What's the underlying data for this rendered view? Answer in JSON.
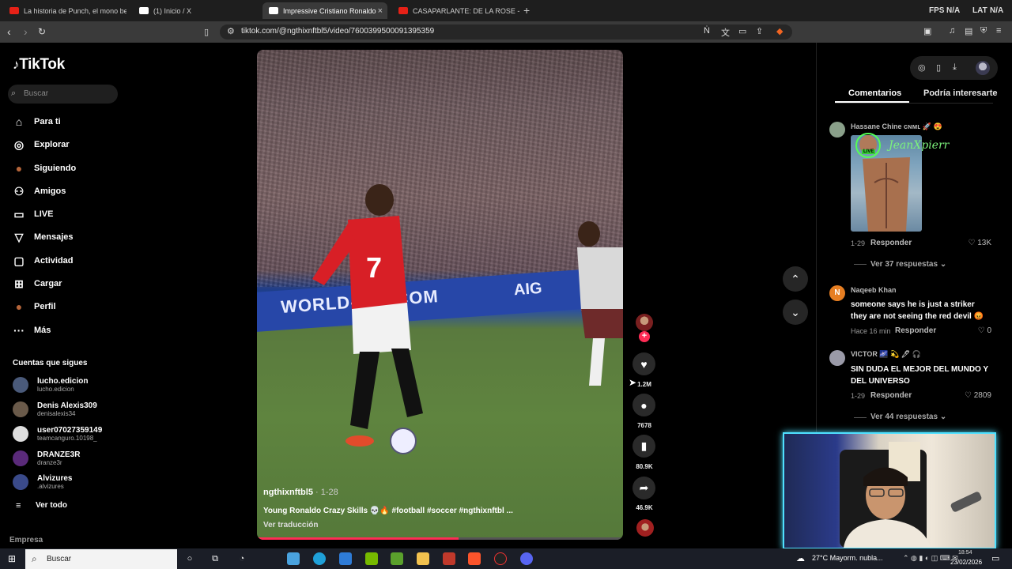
{
  "browser": {
    "tabs": [
      {
        "title": "La historia de Punch, el mono bebé, ...",
        "color": "#e62117",
        "active": false
      },
      {
        "title": "(1) Inicio / X",
        "color": "#ffffff",
        "active": false
      },
      {
        "title": "Impressive Cristiano Ronaldo",
        "color": "#ffffff",
        "active": true
      },
      {
        "title": "CASAPARLANTE: DE LA ROSE - YouTube",
        "color": "#e62117",
        "active": false
      }
    ],
    "new_tab": "+",
    "fps_label": "FPS",
    "fps_value": "N/A",
    "lat_label": "LAT",
    "lat_value": "N/A",
    "url": "tiktok.com/@ngthixnftbl5/video/7600399500091395359"
  },
  "sidebar": {
    "logo": "TikTok",
    "search_placeholder": "Buscar",
    "nav": [
      {
        "label": "Para ti",
        "icon": "home-icon",
        "glyph": "⌂"
      },
      {
        "label": "Explorar",
        "icon": "compass-icon",
        "glyph": "◎"
      },
      {
        "label": "Siguiendo",
        "icon": "following-avatar-icon",
        "glyph": "●"
      },
      {
        "label": "Amigos",
        "icon": "friends-icon",
        "glyph": "⚇"
      },
      {
        "label": "LIVE",
        "icon": "live-tv-icon",
        "glyph": "▭"
      },
      {
        "label": "Mensajes",
        "icon": "messages-icon",
        "glyph": "▽"
      },
      {
        "label": "Actividad",
        "icon": "activity-icon",
        "glyph": "▢"
      },
      {
        "label": "Cargar",
        "icon": "upload-icon",
        "glyph": "⊞"
      },
      {
        "label": "Perfil",
        "icon": "profile-avatar-icon",
        "glyph": "●"
      },
      {
        "label": "Más",
        "icon": "more-icon",
        "glyph": "···"
      }
    ],
    "following_title": "Cuentas que sigues",
    "accounts": [
      {
        "name": "lucho.edicion",
        "handle": "lucho.edicion",
        "color": "#4a5a7a"
      },
      {
        "name": "Denis Alexis309",
        "handle": "denisalexis34",
        "color": "#6a5a4a"
      },
      {
        "name": "user07027359149",
        "handle": "teamcanguro.10198_",
        "color": "#dddddd"
      },
      {
        "name": "DRANZE3R",
        "handle": "dranze3r",
        "color": "#5a2a7a"
      },
      {
        "name": "Alvizures",
        "handle": ".alvizures",
        "color": "#3a4a8a"
      }
    ],
    "see_all": "Ver todo",
    "footer": "Empresa"
  },
  "video": {
    "banner_text": "WORLD-AIG.COM",
    "aig": "AIG",
    "author": "ngthixnftbl5",
    "date": " · 1-28",
    "caption": "Young Ronaldo Crazy Skills 💀🔥 #football #soccer #ngthixnftbl ...",
    "translate": "Ver traducción",
    "progress": 0.55,
    "likes": "1.2M",
    "comments": "7678",
    "saves": "80.9K",
    "shares": "46.9K"
  },
  "panel": {
    "tab_comments": "Comentarios",
    "tab_suggest": "Podría interesarte",
    "sticker_text": "JeanXpierr",
    "live_tag": "LIVE",
    "comments": [
      {
        "name": "Hassane Chine ᴄɴᴍʟ 🚀 😍",
        "text": "",
        "date": "1-29",
        "reply": "Responder",
        "likes": "13K",
        "more": "Ver 37 respuestas",
        "avatar": "#8aa08a"
      },
      {
        "name": "Naqeeb Khan",
        "text": "someone says he is just a striker they are not seeing the red devil 😡",
        "date": "Hace 16 min",
        "reply": "Responder",
        "likes": "0",
        "more": "",
        "avatar": "#e67e22"
      },
      {
        "name": "VICTOR 🌌 💫 🖊 🎧",
        "text": "SIN DUDA EL MEJOR DEL MUNDO Y DEL UNIVERSO",
        "date": "1-29",
        "reply": "Responder",
        "likes": "2809",
        "more": "Ver 44 respuestas",
        "avatar": "#9a9aa8"
      }
    ]
  },
  "taskbar": {
    "search": "Buscar",
    "weather": "27°C  Mayorm. nubla...",
    "time": "18:54",
    "date": "23/02/2026"
  }
}
